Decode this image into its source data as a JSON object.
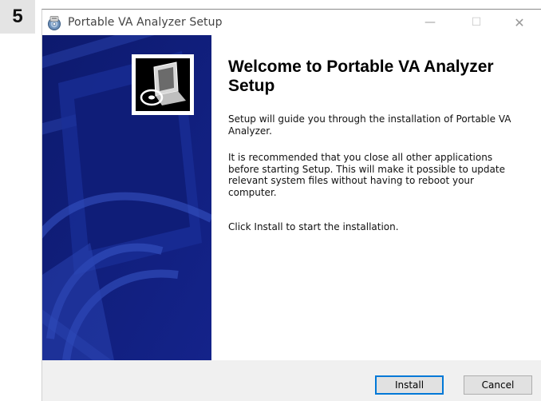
{
  "step": {
    "number": "5"
  },
  "window": {
    "title": "Portable VA Analyzer Setup",
    "controls": {
      "minimize": "—",
      "maximize": "☐",
      "close": "✕"
    }
  },
  "content": {
    "heading": "Welcome to Portable VA Analyzer Setup",
    "paragraphs": [
      "Setup will guide you through the installation of Portable VA Analyzer.",
      "It is recommended that you close all other applications before starting Setup. This will make it possible to update relevant system files without having to reboot your computer.",
      "Click Install to start the installation."
    ]
  },
  "buttons": {
    "install": "Install",
    "cancel": "Cancel"
  },
  "colors": {
    "side_panel": "#101c7a",
    "accent": "#0078d7",
    "footer": "#f0f0f0"
  },
  "icons": {
    "app": "installer-disc-icon",
    "side": "computer-cd-icon"
  }
}
